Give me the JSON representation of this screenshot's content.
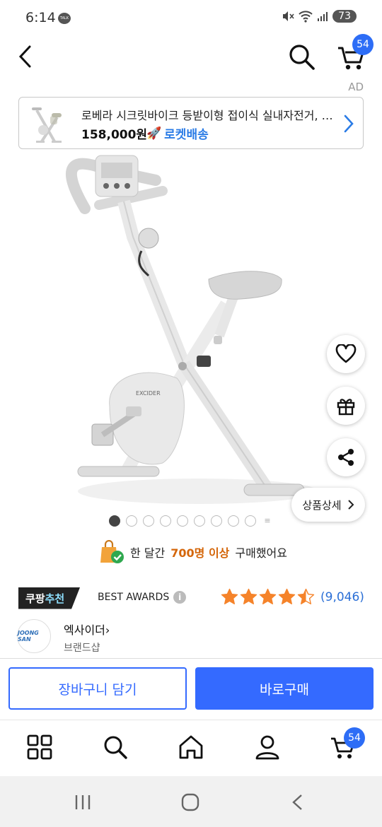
{
  "status_bar": {
    "time": "6:14",
    "talk_label": "TALK",
    "battery": "73"
  },
  "header": {
    "cart_badge": "54",
    "ad_label": "AD"
  },
  "ad_banner": {
    "title": "로베라 시크릿바이크 등받이형 접이식 실내자전거, 화이트",
    "price": "158,000원",
    "delivery": "로켓배송"
  },
  "gallery": {
    "total_dots": 9,
    "active_index": 0,
    "detail_button": "상품상세"
  },
  "purchase_notice": {
    "prefix": "한 달간",
    "highlight": "700명 이상",
    "suffix": "구매했어요"
  },
  "recommendation": {
    "badge_part1": "쿠팡",
    "badge_part2": "추천",
    "award": "BEST AWARDS",
    "rating": 4.5,
    "review_count": "(9,046)"
  },
  "brand": {
    "logo_text": "JOONG SAN",
    "name": "엑사이더",
    "shop_label": "브랜드샵"
  },
  "actions": {
    "add_to_cart": "장바구니 담기",
    "buy_now": "바로구매"
  },
  "bottom_nav": {
    "cart_badge": "54"
  },
  "colors": {
    "accent": "#346aff",
    "badge": "#2d6df6",
    "star": "#f5832a",
    "rocket": "#2b7ce6",
    "highlight": "#d4660a"
  }
}
